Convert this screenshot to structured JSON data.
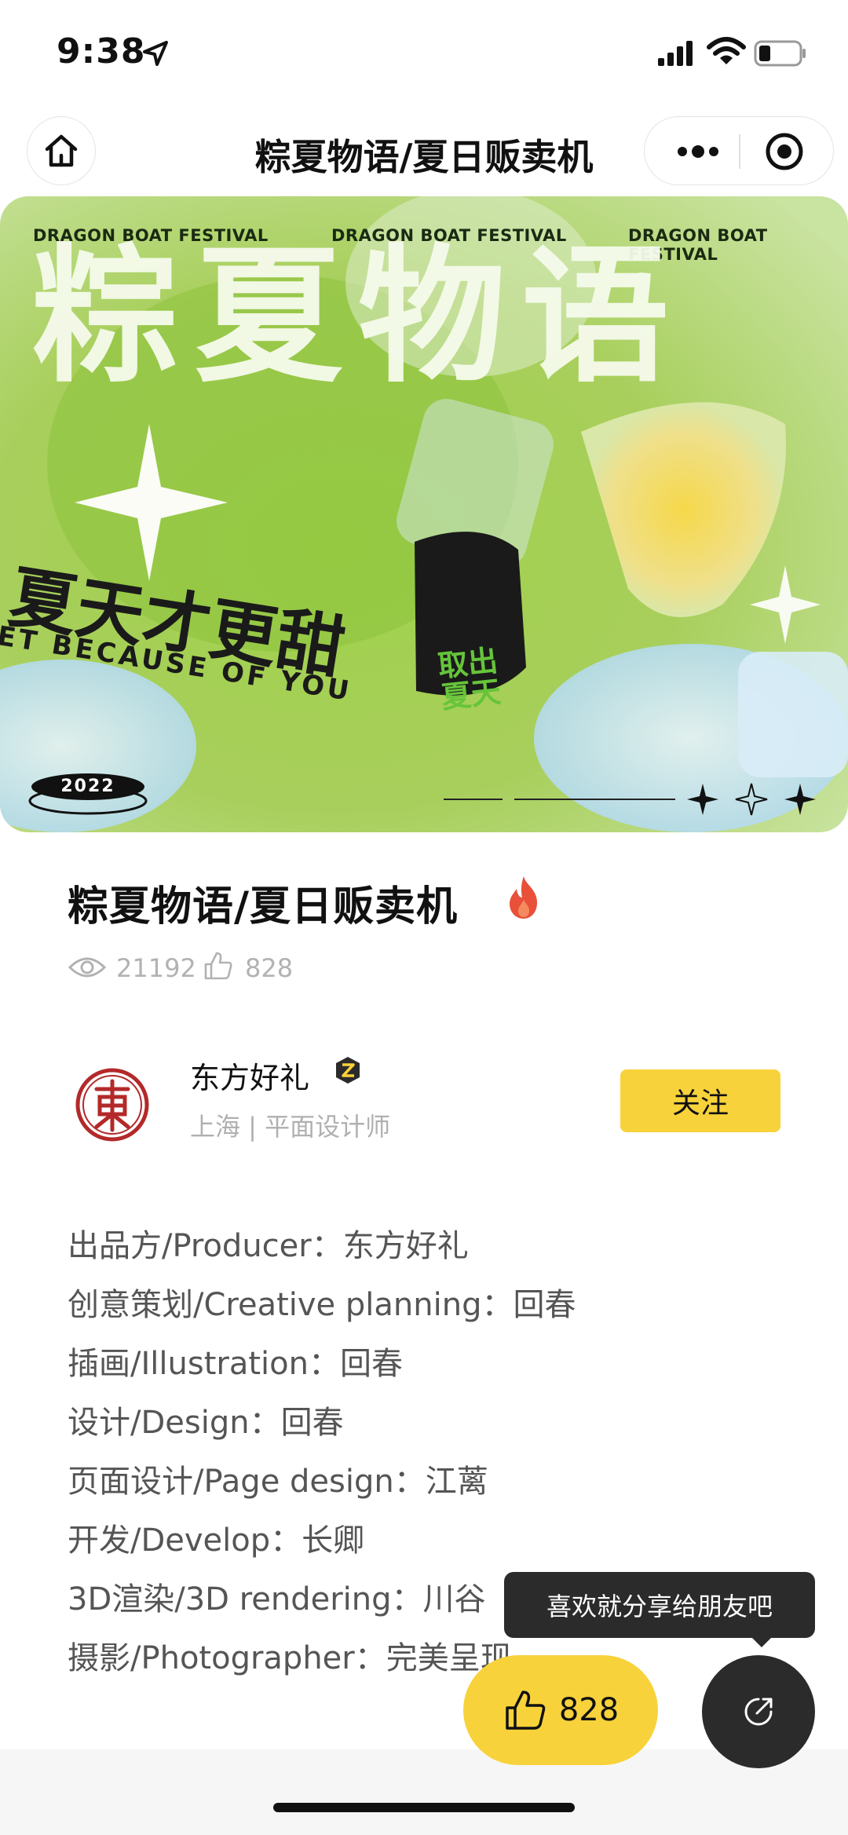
{
  "status_bar": {
    "time": "9:38",
    "icons": [
      "location-arrow-icon",
      "cellular-signal-icon",
      "wifi-icon",
      "battery-icon"
    ]
  },
  "nav": {
    "title": "粽夏物语/夏日贩卖机",
    "icons": [
      "home-icon",
      "more-dots-icon",
      "close-target-icon"
    ]
  },
  "banner": {
    "tag_left": "DRAGON BOAT FESTIVAL",
    "tag_center": "DRAGON BOAT FESTIVAL",
    "tag_right": "DRAGON BOAT FESTIVAL",
    "big_text": "粽夏物语",
    "slogan": "夏天才更甜",
    "slogan_en": "ET BECAUSE OF YOU",
    "can_text": "取出夏天",
    "year": "2022"
  },
  "work": {
    "title": "粽夏物语/夏日贩卖机",
    "views": "21192",
    "likes": "828"
  },
  "author": {
    "name": "东方好礼",
    "meta": "上海 | 平面设计师",
    "follow_label": "关注",
    "badge": "Z"
  },
  "credits": [
    "出品方/Producer：东方好礼",
    "创意策划/Creative planning：回春",
    "插画/Illustration：回春",
    "设计/Design：回春",
    "页面设计/Page design：江蓠",
    "开发/Develop：长卿",
    "3D渲染/3D rendering：川谷",
    "摄影/Photographer：完美呈现"
  ],
  "actions": {
    "like_count": "828",
    "share_tooltip": "喜欢就分享给朋友吧"
  },
  "colors": {
    "accent_yellow": "#f8d23b",
    "dark": "#2b2b2b",
    "banner_green": "#9cc64a",
    "fire_red": "#e8503a"
  }
}
